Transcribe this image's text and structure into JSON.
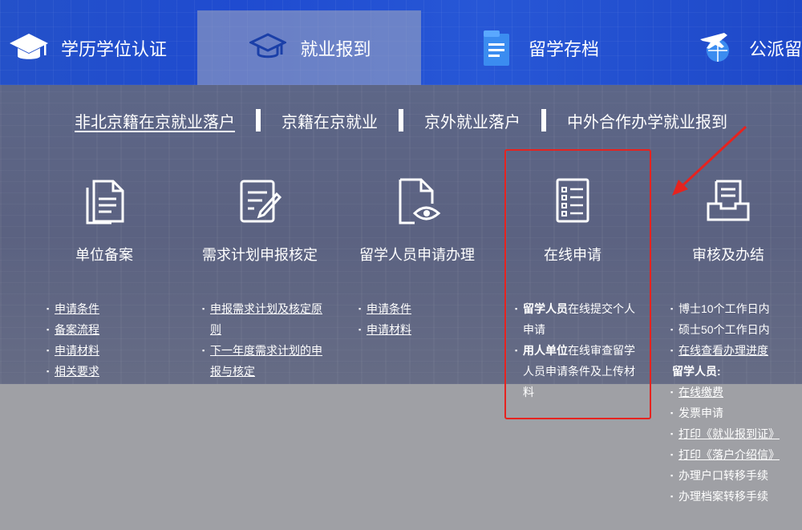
{
  "nav": {
    "tabs": [
      {
        "label": "学历学位认证",
        "icon": "graduation-cap-icon"
      },
      {
        "label": "就业报到",
        "icon": "mortarboard-outline-icon",
        "active": true
      },
      {
        "label": "留学存档",
        "icon": "document-folder-icon"
      },
      {
        "label": "公派留",
        "icon": "airplane-globe-icon"
      }
    ]
  },
  "subnav": {
    "items": [
      {
        "label": "非北京籍在京就业落户",
        "current": true
      },
      {
        "label": "京籍在京就业"
      },
      {
        "label": "京外就业落户"
      },
      {
        "label": "中外合作办学就业报到"
      }
    ]
  },
  "steps": [
    {
      "title": "单位备案",
      "icon": "documents-icon",
      "links": [
        "申请条件",
        "备案流程",
        "申请材料",
        "相关要求"
      ]
    },
    {
      "title": "需求计划申报核定",
      "icon": "form-edit-icon",
      "links": [
        "申报需求计划及核定原则",
        "下一年度需求计划的申报与核定"
      ]
    },
    {
      "title": "留学人员申请办理",
      "icon": "document-eye-icon",
      "links": [
        "申请条件",
        "申请材料"
      ]
    },
    {
      "title": "在线申请",
      "icon": "checklist-icon",
      "items": [
        {
          "bold": "留学人员",
          "text": "在线提交个人申请"
        },
        {
          "bold": "用人单位",
          "text": "在线审查留学人员申请条件及上传材料"
        }
      ]
    },
    {
      "title": "审核及办结",
      "icon": "inbox-tray-icon",
      "items": [
        {
          "text": "博士10个工作日内"
        },
        {
          "text": "硕士50个工作日内"
        },
        {
          "link": "在线查看办理进度"
        },
        {
          "heading": "留学人员:"
        },
        {
          "link": "在线缴费"
        },
        {
          "text": "发票申请"
        },
        {
          "link": "打印《就业报到证》"
        },
        {
          "link": "打印《落户介绍信》"
        },
        {
          "text": "办理户口转移手续"
        },
        {
          "text": "办理档案转移手续"
        }
      ]
    }
  ],
  "colors": {
    "nav_blue": "#2451c9",
    "highlight_red": "#e6231f",
    "panel": "#5d6687",
    "page_bg": "#9fa0a5"
  }
}
